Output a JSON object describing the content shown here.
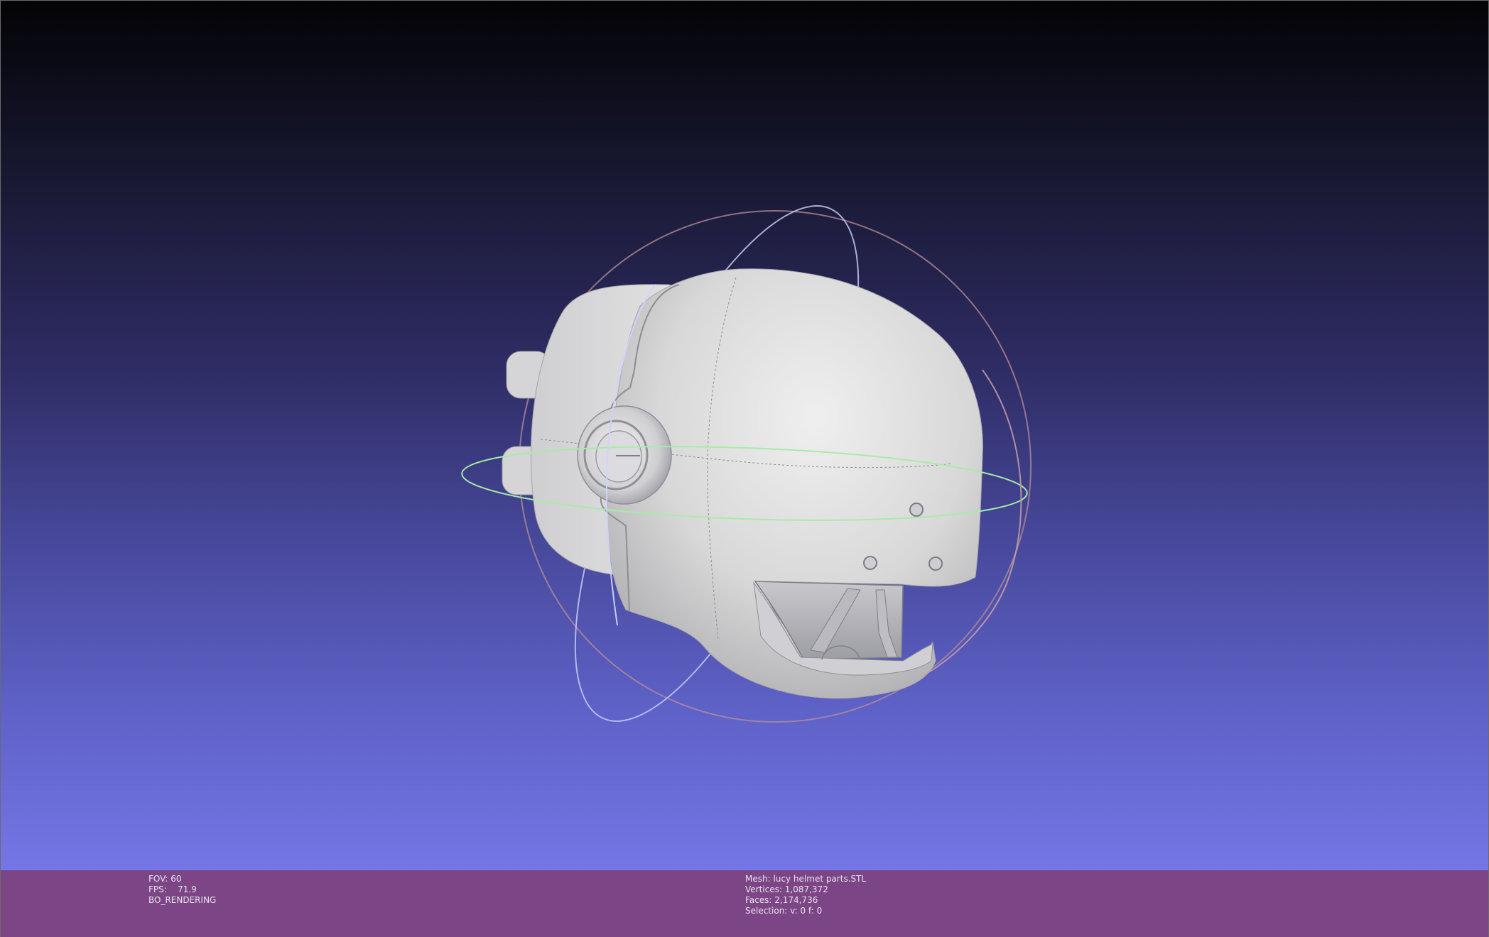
{
  "viewport": {
    "background_top": "#030306",
    "background_bottom": "#7476e6",
    "model_color": "#d6d6d6",
    "trackball_colors": {
      "horizontal": "#9ee8a8",
      "vertical_front": "#c0c4f4",
      "outer": "#c89a9a"
    }
  },
  "info_left": {
    "fov_label": "FOV:",
    "fov_value": "60",
    "fps_label": "FPS:",
    "fps_value": "71.9",
    "mode": "BO_RENDERING"
  },
  "info_right": {
    "mesh_label": "Mesh:",
    "mesh_name": "lucy helmet parts.STL",
    "vertices_label": "Vertices:",
    "vertices_value": "1,087,372",
    "faces_label": "Faces:",
    "faces_value": "2,174,736",
    "selection_label": "Selection:",
    "selection_value": "v: 0 f: 0"
  },
  "info_bar_color": "#7c4585"
}
